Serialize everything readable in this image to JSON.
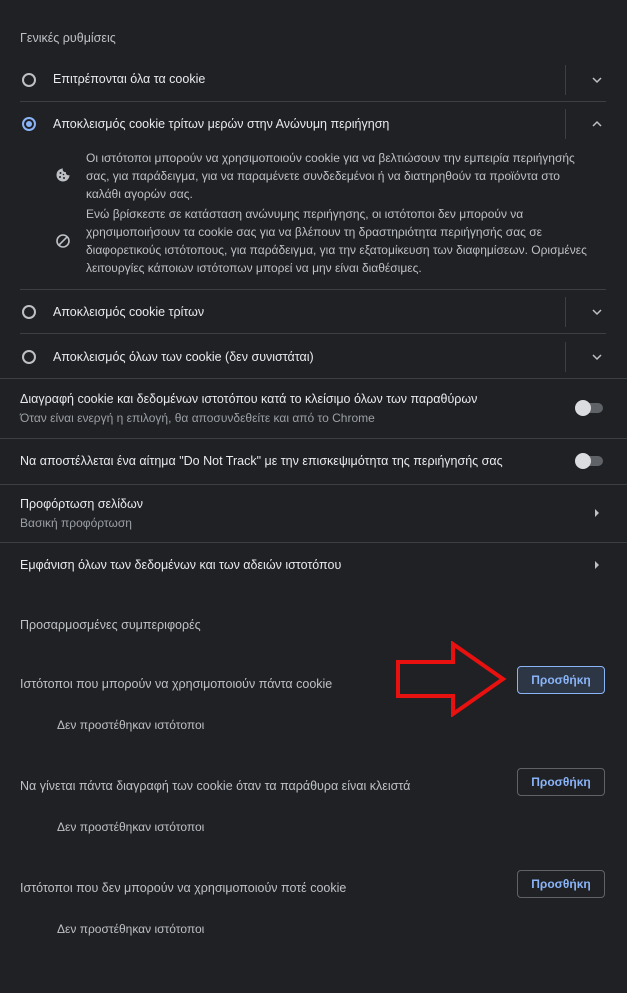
{
  "general": {
    "title": "Γενικές ρυθμίσεις",
    "options": [
      {
        "label": "Επιτρέπονται όλα τα cookie",
        "selected": false
      },
      {
        "label": "Αποκλεισμός cookie τρίτων μερών στην Ανώνυμη περιήγηση",
        "selected": true
      },
      {
        "label": "Αποκλεισμός cookie τρίτων",
        "selected": false
      },
      {
        "label": "Αποκλεισμός όλων των cookie (δεν συνιστάται)",
        "selected": false
      }
    ],
    "details": [
      {
        "icon": "cookie-icon",
        "lines": [
          "Οι ιστότοποι μπορούν να χρησιμοποιούν cookie για να βελτιώσουν την εμπειρία περιήγησής",
          "σας, για παράδειγμα, για να παραμένετε συνδεδεμένοι ή να διατηρηθούν τα προϊόντα στο",
          "καλάθι αγορών σας."
        ]
      },
      {
        "icon": "block-icon",
        "lines": [
          "Ενώ βρίσκεστε σε κατάσταση ανώνυμης περιήγησης, οι ιστότοποι δεν μπορούν να",
          "χρησιμοποιήσουν τα cookie σας για να βλέπουν τη δραστηριότητα περιήγησής σας σε",
          "διαφορετικούς ιστότοπους, για παράδειγμα, για την εξατομίκευση των διαφημίσεων. Ορισμένες",
          "λειτουργίες κάποιων ιστότοπων μπορεί να μην είναι διαθέσιμες."
        ]
      }
    ]
  },
  "settings": {
    "clear_on_exit": {
      "title": "Διαγραφή cookie και δεδομένων ιστοτόπου κατά το κλείσιμο όλων των παραθύρων",
      "subtitle": "Όταν είναι ενεργή η επιλογή, θα αποσυνδεθείτε και από το Chrome",
      "enabled": false
    },
    "do_not_track": {
      "title": "Να αποστέλλεται ένα αίτημα \"Do Not Track\" με την επισκεψιμότητα της περιήγησής σας",
      "enabled": false
    },
    "preload": {
      "title": "Προφόρτωση σελίδων",
      "subtitle": "Βασική προφόρτωση"
    },
    "all_site_data": {
      "title": "Εμφάνιση όλων των δεδομένων και των αδειών ιστοτόπου"
    }
  },
  "custom": {
    "title": "Προσαρμοσμένες συμπεριφορές",
    "groups": [
      {
        "label": "Ιστότοποι που μπορούν να χρησιμοποιούν πάντα cookie",
        "button": "Προσθήκη",
        "empty": "Δεν προστέθηκαν ιστότοποι"
      },
      {
        "label": "Να γίνεται πάντα διαγραφή των cookie όταν τα παράθυρα είναι κλειστά",
        "button": "Προσθήκη",
        "empty": "Δεν προστέθηκαν ιστότοποι"
      },
      {
        "label": "Ιστότοποι που δεν μπορούν να χρησιμοποιούν ποτέ cookie",
        "button": "Προσθήκη",
        "empty": "Δεν προστέθηκαν ιστότοποι"
      }
    ]
  },
  "colors": {
    "background": "#202124",
    "accent": "#8ab4f8",
    "annotation_arrow": "#e8110f"
  }
}
